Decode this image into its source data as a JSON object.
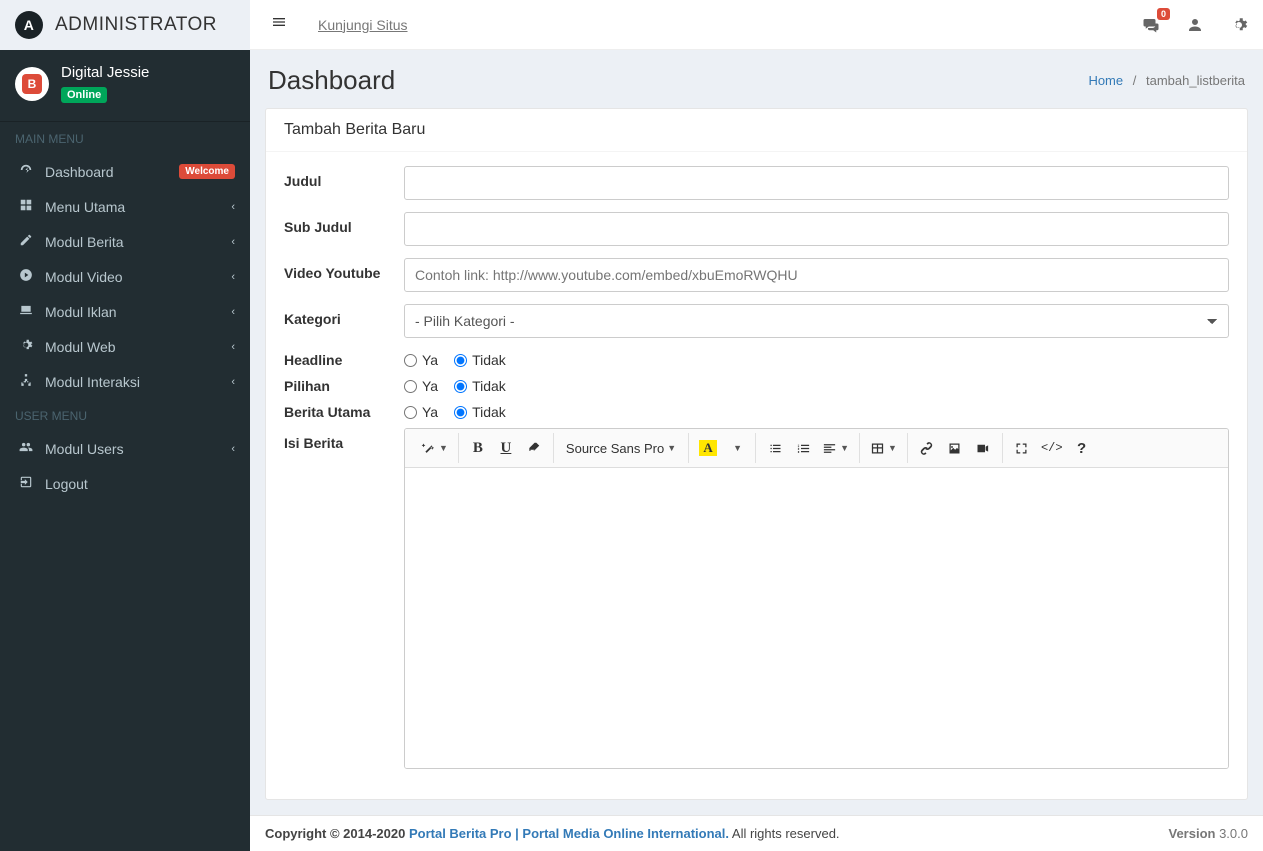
{
  "brand": {
    "logo_letter": "A",
    "title": "ADMINISTRATOR"
  },
  "user": {
    "avatar_letter": "B",
    "name": "Digital Jessie",
    "status": "Online"
  },
  "sidebar": {
    "main_header": "MAIN MENU",
    "user_header": "USER MENU",
    "main_items": [
      {
        "label": "Dashboard",
        "badge": "Welcome"
      },
      {
        "label": "Menu Utama"
      },
      {
        "label": "Modul Berita"
      },
      {
        "label": "Modul Video"
      },
      {
        "label": "Modul Iklan"
      },
      {
        "label": "Modul Web"
      },
      {
        "label": "Modul Interaksi"
      }
    ],
    "user_items": [
      {
        "label": "Modul Users"
      },
      {
        "label": "Logout"
      }
    ]
  },
  "topbar": {
    "visit_site": "Kunjungi Situs",
    "noti_count": "0"
  },
  "header": {
    "title": "Dashboard",
    "breadcrumb_home": "Home",
    "breadcrumb_sep": "/",
    "breadcrumb_current": "tambah_listberita"
  },
  "box": {
    "title": "Tambah Berita Baru"
  },
  "form": {
    "judul_label": "Judul",
    "subjudul_label": "Sub Judul",
    "video_label": "Video Youtube",
    "video_placeholder": "Contoh link: http://www.youtube.com/embed/xbuEmoRWQHU",
    "kategori_label": "Kategori",
    "kategori_default": "- Pilih Kategori -",
    "headline_label": "Headline",
    "pilihan_label": "Pilihan",
    "utama_label": "Berita Utama",
    "radio_ya": "Ya",
    "radio_tidak": "Tidak",
    "isi_label": "Isi Berita"
  },
  "editor": {
    "font_label": "Source Sans Pro",
    "highlight_letter": "A"
  },
  "footer": {
    "copyright_prefix": "Copyright © 2014-2020 ",
    "link_text": "Portal Berita Pro | Portal Media Online International.",
    "rights": " All rights reserved.",
    "version_label": "Version ",
    "version_num": "3.0.0"
  }
}
